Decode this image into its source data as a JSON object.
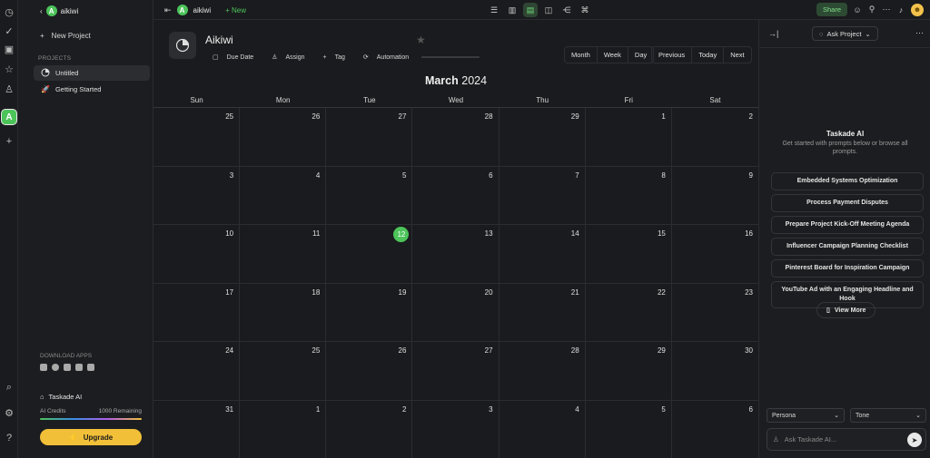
{
  "workspace": {
    "name": "aikiwi",
    "initial": "A"
  },
  "sidebar": {
    "new_project": "New Project",
    "section_label": "PROJECTS",
    "projects": [
      {
        "label": "Untitled"
      },
      {
        "label": "Getting Started"
      }
    ],
    "download_label": "DOWNLOAD APPS",
    "ai_label": "Taskade AI",
    "credits_label": "AI Credits",
    "credits_remaining": "1000 Remaining",
    "upgrade_label": "Upgrade"
  },
  "topbar": {
    "workspace": "aikiwi",
    "new_label": "New",
    "share_label": "Share"
  },
  "project": {
    "title": "Aikiwi",
    "actions": [
      "Due Date",
      "Assign",
      "Tag",
      "Automation"
    ]
  },
  "calendar": {
    "view_buttons": [
      "Month",
      "Week",
      "Day"
    ],
    "nav_buttons": [
      "Previous",
      "Today",
      "Next"
    ],
    "month": "March",
    "year": "2024",
    "weekdays": [
      "Sun",
      "Mon",
      "Tue",
      "Wed",
      "Thu",
      "Fri",
      "Sat"
    ],
    "days": [
      [
        "25",
        "26",
        "27",
        "28",
        "29",
        "1",
        "2"
      ],
      [
        "3",
        "4",
        "5",
        "6",
        "7",
        "8",
        "9"
      ],
      [
        "10",
        "11",
        "12",
        "13",
        "14",
        "15",
        "16"
      ],
      [
        "17",
        "18",
        "19",
        "20",
        "21",
        "22",
        "23"
      ],
      [
        "24",
        "25",
        "26",
        "27",
        "28",
        "29",
        "30"
      ],
      [
        "31",
        "1",
        "2",
        "3",
        "4",
        "5",
        "6"
      ]
    ],
    "today": "12"
  },
  "ai_panel": {
    "mode_label": "Ask Project",
    "title": "Taskade AI",
    "subtitle": "Get started with prompts below or browse all prompts.",
    "prompts": [
      "Embedded Systems Optimization",
      "Process Payment Disputes",
      "Prepare Project Kick-Off Meeting Agenda",
      "Influencer Campaign Planning Checklist",
      "Pinterest Board for Inspiration Campaign",
      "YouTube Ad with an Engaging Headline and Hook"
    ],
    "view_more": "View More",
    "persona": "Persona",
    "tone": "Tone",
    "input_placeholder": "Ask Taskade AI..."
  },
  "colors": {
    "accent": "#4cc45a",
    "upgrade": "#f2c038",
    "background": "#1a1b1e"
  }
}
